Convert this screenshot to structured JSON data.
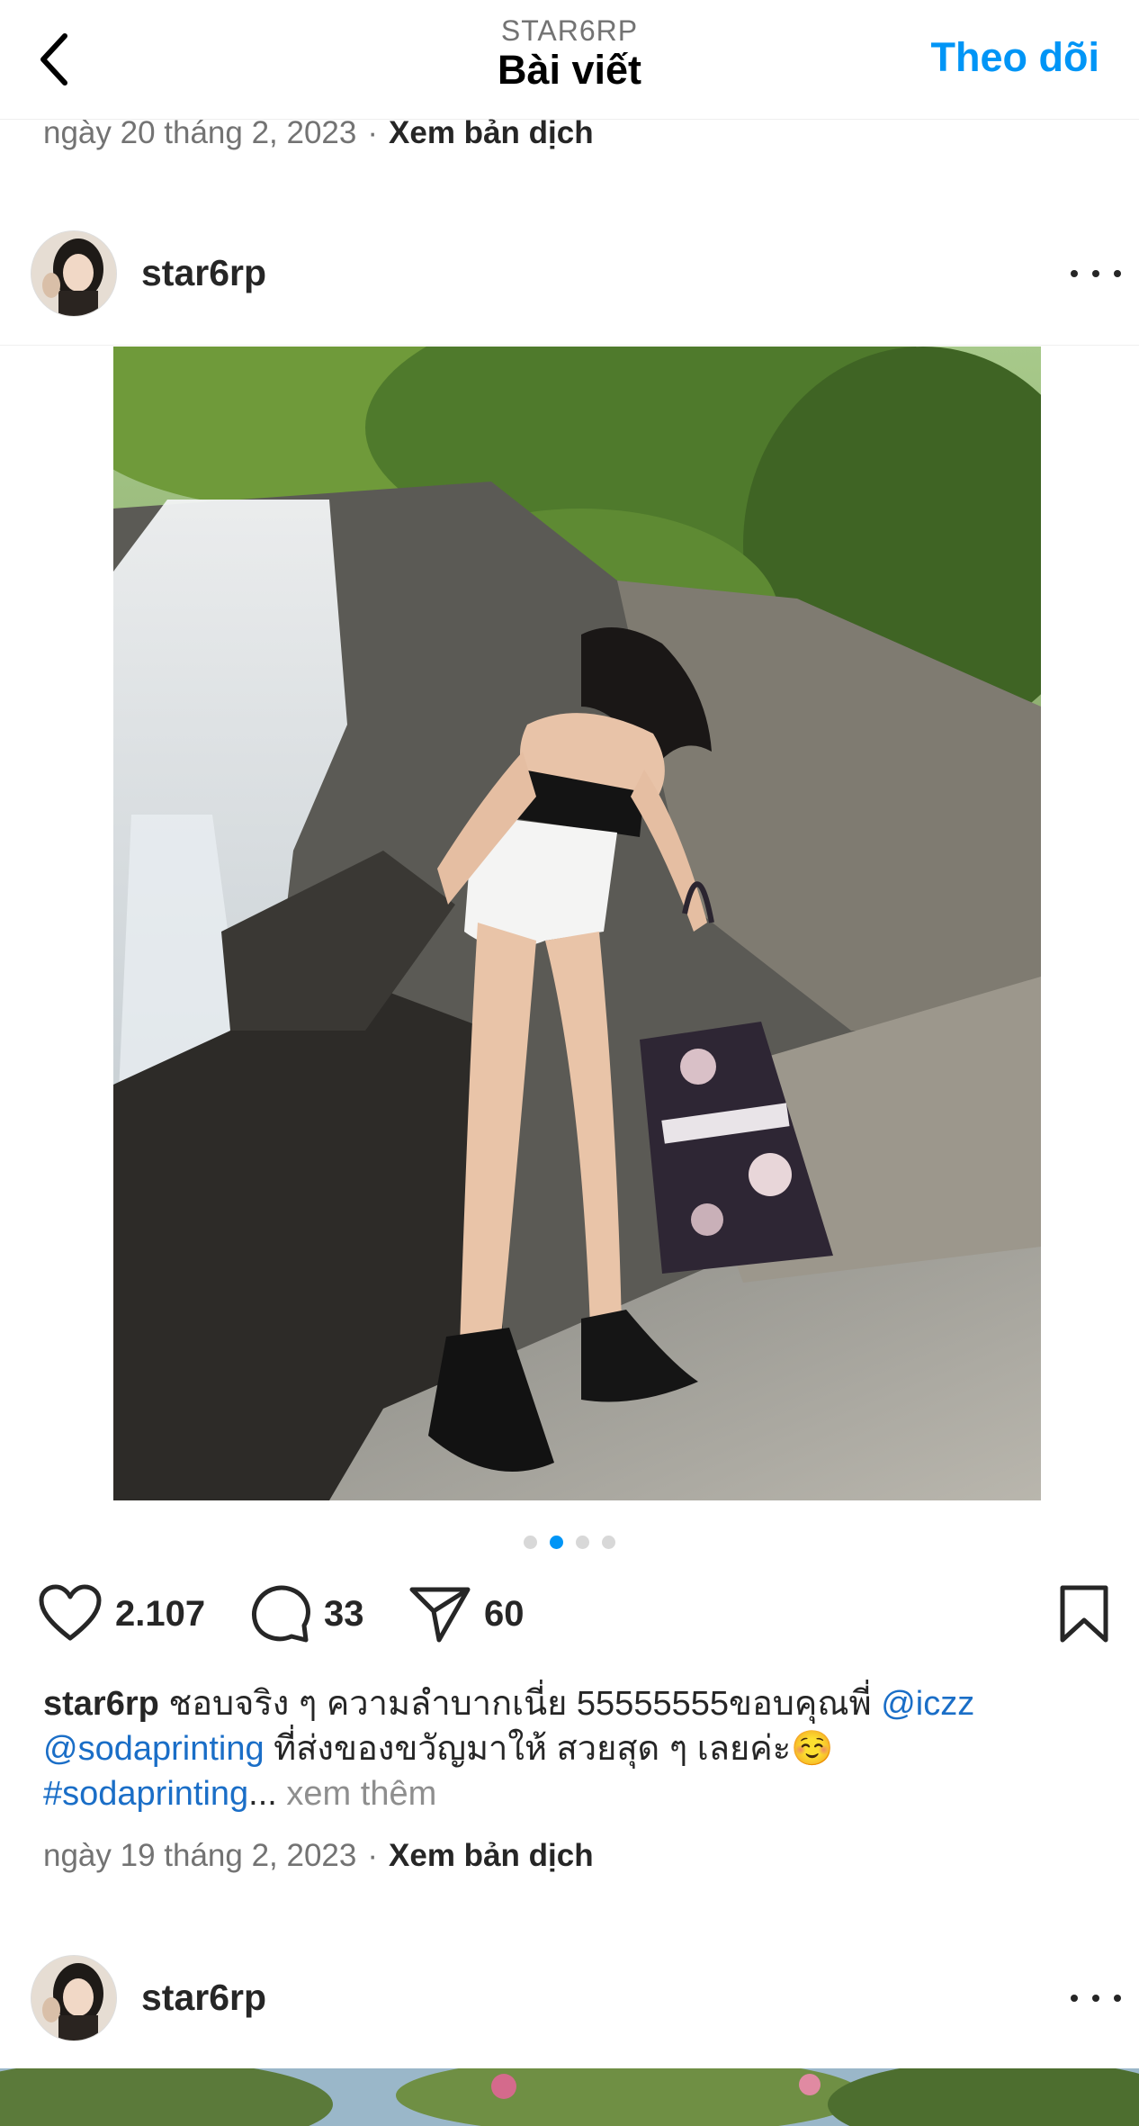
{
  "header": {
    "username": "STAR6RP",
    "title": "Bài viết",
    "follow_label": "Theo dõi",
    "back_icon": "chevron-left-icon"
  },
  "prev_post": {
    "date": "ngày 20 tháng 2, 2023",
    "separator": "·",
    "translate": "Xem bản dịch"
  },
  "post": {
    "username": "star6rp",
    "more_icon": "ellipsis-icon",
    "carousel": {
      "total": 4,
      "active_index": 2
    },
    "likes": "2.107",
    "comments": "33",
    "shares": "60",
    "caption": {
      "username": "star6rp",
      "text1": " ชอบจริง ๆ ความลำบากเนี่ย 55555555ขอบคุณพี่ ",
      "mention1": "@iczz",
      "mention2": "@sodaprinting",
      "text2": " ที่ส่งของขวัญมาให้ สวยสุด ๆ เลยค่ะ☺️",
      "hashtag": "#sodaprinting",
      "ellipsis": "...",
      "see_more": " xem thêm"
    },
    "date": "ngày 19 tháng 2, 2023",
    "separator": "·",
    "translate": "Xem bản dịch"
  },
  "next_post": {
    "username": "star6rp"
  },
  "colors": {
    "accent": "#0095f6",
    "mention": "#1a6ec7",
    "text": "#262626",
    "muted": "#737373"
  }
}
